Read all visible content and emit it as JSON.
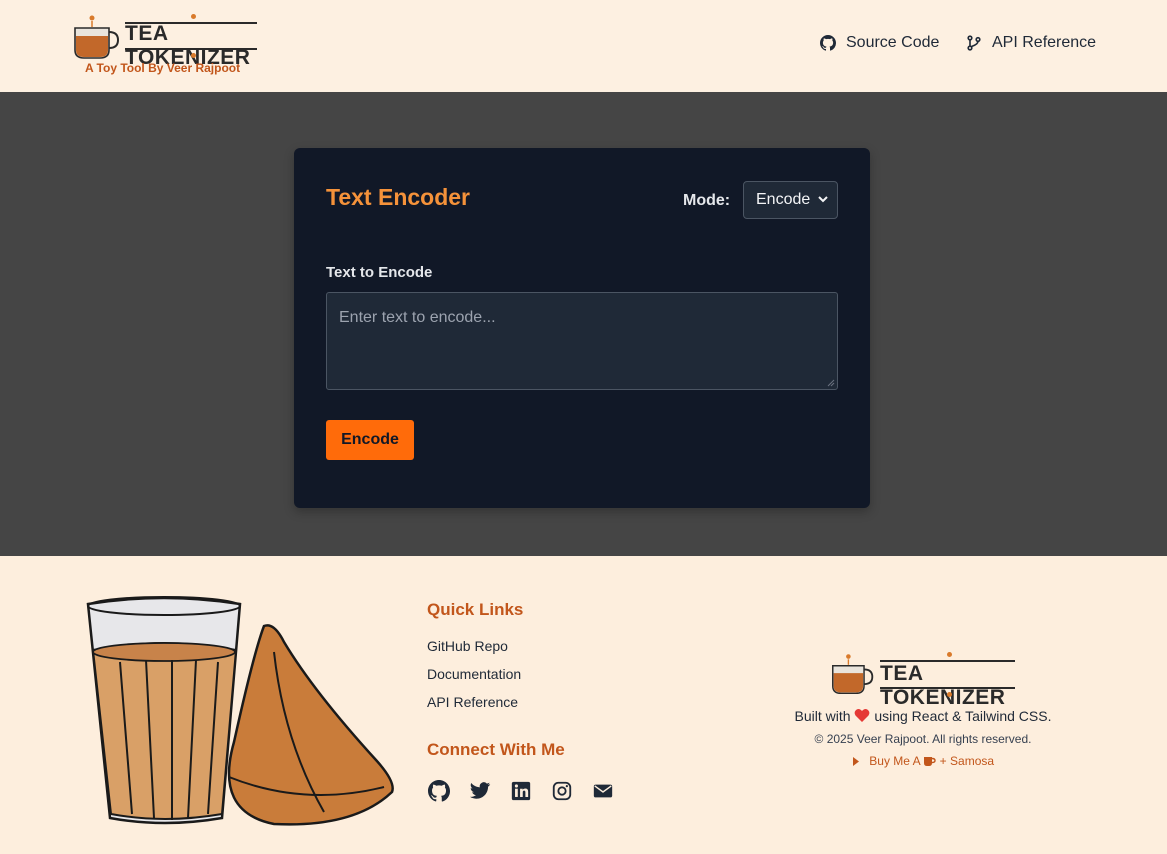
{
  "header": {
    "logo_title": "TEA TOKENIZER",
    "logo_subtitle": "A Toy Tool By Veer Rajpoot",
    "nav": [
      {
        "label": "Source Code",
        "icon": "github-icon"
      },
      {
        "label": "API Reference",
        "icon": "git-branch-icon"
      }
    ]
  },
  "card": {
    "title": "Text Encoder",
    "mode_label": "Mode:",
    "mode_value": "Encode",
    "field_label": "Text to Encode",
    "placeholder": "Enter text to encode...",
    "button_label": "Encode"
  },
  "footer": {
    "quick_links_title": "Quick Links",
    "quick_links": [
      "GitHub Repo",
      "Documentation",
      "API Reference"
    ],
    "connect_title": "Connect With Me",
    "social_icons": [
      "github-icon",
      "twitter-icon",
      "linkedin-icon",
      "instagram-icon",
      "envelope-icon"
    ],
    "logo_title": "TEA TOKENIZER",
    "built_prefix": "Built with",
    "built_suffix": "using React & Tailwind CSS.",
    "copyright": "© 2025 Veer Rajpoot. All rights reserved.",
    "buy_prefix": "Buy Me A",
    "buy_suffix": "+ Samosa"
  },
  "colors": {
    "header_bg": "#fdf0e1",
    "page_bg": "#454545",
    "card_bg": "#111827",
    "accent_orange": "#f5923a",
    "button_orange": "#ff6b0a",
    "footer_bg": "#fdeedd",
    "link_brown": "#c2561b"
  }
}
